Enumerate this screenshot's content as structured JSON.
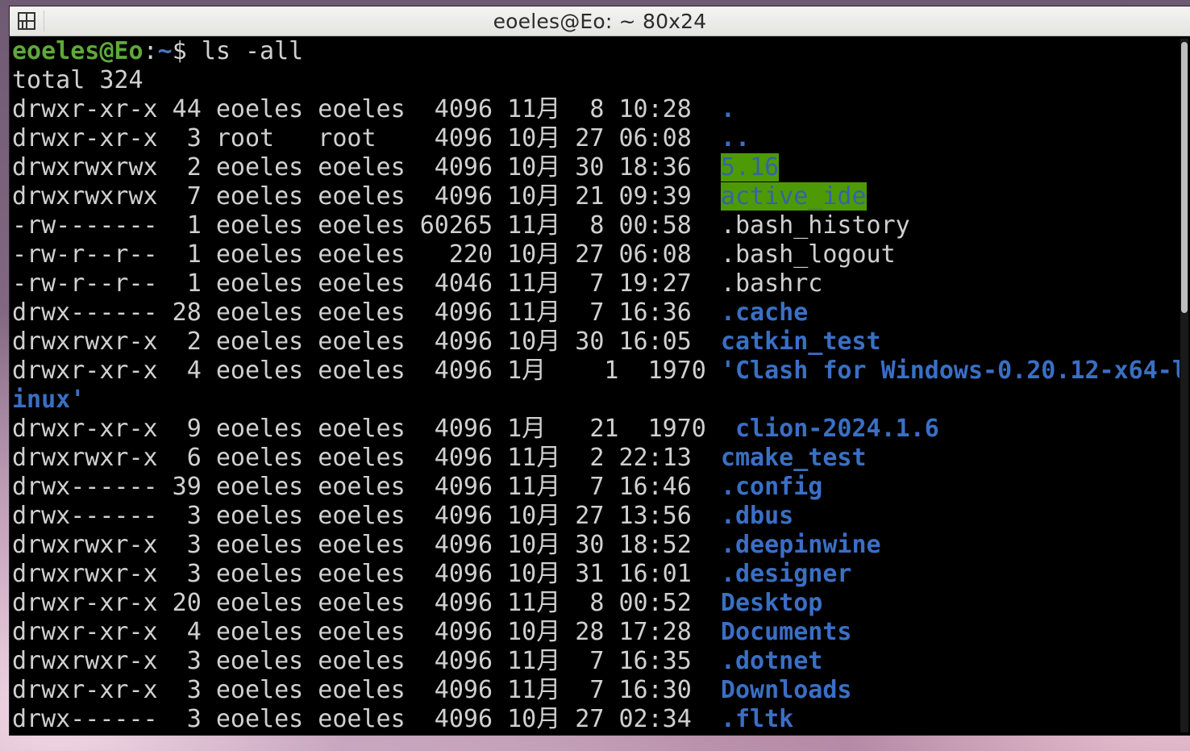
{
  "window": {
    "title": "eoeles@Eo: ~ 80x24"
  },
  "prompt": {
    "user_host": "eoeles@Eo",
    "sep": ":",
    "path": "~",
    "dollar": "$ ",
    "command": "ls -all"
  },
  "total_line": "total 324",
  "rows": [
    {
      "meta": "drwxr-xr-x 44 eoeles eoeles  4096 11月  8 10:28  ",
      "name": ".",
      "kind": "dir"
    },
    {
      "meta": "drwxr-xr-x  3 root   root    4096 10月 27 06:08  ",
      "name": "..",
      "kind": "dir"
    },
    {
      "meta": "drwxrwxrwx  2 eoeles eoeles  4096 10月 30 18:36  ",
      "name": "5.16",
      "kind": "hl"
    },
    {
      "meta": "drwxrwxrwx  7 eoeles eoeles  4096 10月 21 09:39  ",
      "name": "active_ide",
      "kind": "hl"
    },
    {
      "meta": "-rw-------  1 eoeles eoeles 60265 11月  8 00:58  ",
      "name": ".bash_history",
      "kind": "plain"
    },
    {
      "meta": "-rw-r--r--  1 eoeles eoeles   220 10月 27 06:08  ",
      "name": ".bash_logout",
      "kind": "plain"
    },
    {
      "meta": "-rw-r--r--  1 eoeles eoeles  4046 11月  7 19:27  ",
      "name": ".bashrc",
      "kind": "plain"
    },
    {
      "meta": "drwx------ 28 eoeles eoeles  4096 11月  7 16:36  ",
      "name": ".cache",
      "kind": "dir"
    },
    {
      "meta": "drwxrwxr-x  2 eoeles eoeles  4096 10月 30 16:05  ",
      "name": "catkin_test",
      "kind": "dir"
    },
    {
      "meta": "drwxr-xr-x  4 eoeles eoeles  4096 1月    1  1970 ",
      "name": "'Clash for Windows-0.20.12-x64-l",
      "kind": "dir"
    },
    {
      "meta": "",
      "name": "inux'",
      "kind": "dir"
    },
    {
      "meta": "drwxr-xr-x  9 eoeles eoeles  4096 1月   21  1970  ",
      "name": "clion-2024.1.6",
      "kind": "dir"
    },
    {
      "meta": "drwxrwxr-x  6 eoeles eoeles  4096 11月  2 22:13  ",
      "name": "cmake_test",
      "kind": "dir"
    },
    {
      "meta": "drwx------ 39 eoeles eoeles  4096 11月  7 16:46  ",
      "name": ".config",
      "kind": "dir"
    },
    {
      "meta": "drwx------  3 eoeles eoeles  4096 10月 27 13:56  ",
      "name": ".dbus",
      "kind": "dir"
    },
    {
      "meta": "drwxrwxr-x  3 eoeles eoeles  4096 10月 30 18:52  ",
      "name": ".deepinwine",
      "kind": "dir"
    },
    {
      "meta": "drwxrwxr-x  3 eoeles eoeles  4096 10月 31 16:01  ",
      "name": ".designer",
      "kind": "dir"
    },
    {
      "meta": "drwxr-xr-x 20 eoeles eoeles  4096 11月  8 00:52  ",
      "name": "Desktop",
      "kind": "dir"
    },
    {
      "meta": "drwxr-xr-x  4 eoeles eoeles  4096 10月 28 17:28  ",
      "name": "Documents",
      "kind": "dir"
    },
    {
      "meta": "drwxrwxr-x  3 eoeles eoeles  4096 11月  7 16:35  ",
      "name": ".dotnet",
      "kind": "dir"
    },
    {
      "meta": "drwxr-xr-x  3 eoeles eoeles  4096 11月  7 16:30  ",
      "name": "Downloads",
      "kind": "dir"
    },
    {
      "meta": "drwx------  3 eoeles eoeles  4096 10月 27 02:34  ",
      "name": ".fltk",
      "kind": "dir"
    }
  ],
  "icons": {
    "menu": "terminal-menu-icon"
  }
}
